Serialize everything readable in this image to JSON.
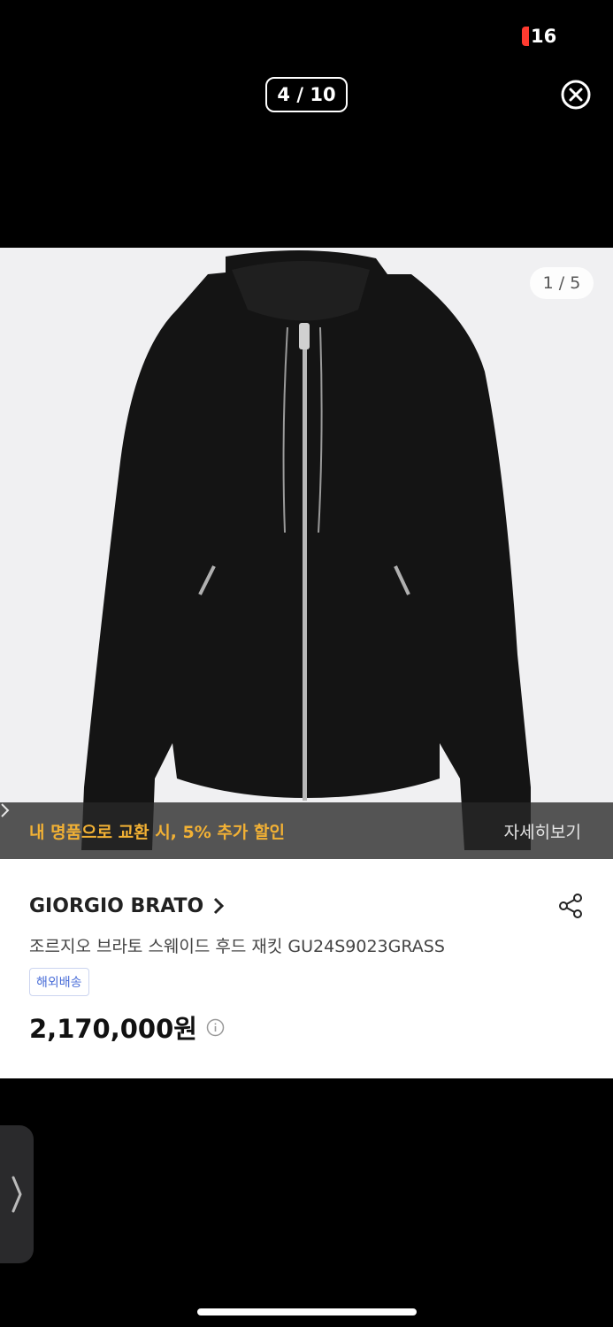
{
  "status_bar": {
    "time": "16"
  },
  "viewer": {
    "counter": "4 / 10"
  },
  "product": {
    "image_counter": "1 / 5",
    "promo_text": "내 명품으로 교환 시, 5% 추가 할인",
    "promo_link": "자세히보기",
    "brand": "GIORGIO BRATO",
    "name": "조르지오 브라토 스웨이드 후드 재킷 GU24S9023GRASS",
    "tag": "해외배송",
    "price": "2,170,000원"
  },
  "icons": {
    "close": "close-circle-icon",
    "share": "share-icon",
    "info": "info-icon",
    "brand_chevron": "chevron-right-icon",
    "promo_chevron": "chevron-right-icon",
    "side_tab": "chevron-right-icon"
  },
  "colors": {
    "promo_accent": "#f2b134",
    "tag_blue": "#4a6ed8",
    "record_dot": "#ff3b30"
  }
}
